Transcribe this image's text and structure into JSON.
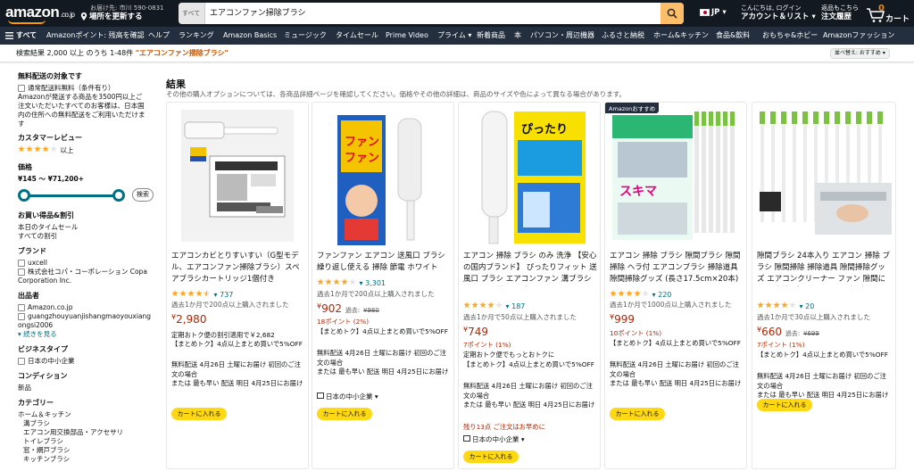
{
  "header": {
    "logo": "amazon",
    "logo_suffix": ".co.jp",
    "deliver_line1": "お届け先: 市川 590-0831",
    "deliver_line2": "場所を更新する",
    "search_category": "すべて",
    "search_query": "エアコンファン掃除ブラシ",
    "lang": "JP",
    "account_line1": "こんにちは, ログイン",
    "account_line2": "アカウント＆リスト",
    "orders_line1": "返品もこちら",
    "orders_line2": "注文履歴",
    "cart_count": "0",
    "cart_label": "カート"
  },
  "nav": {
    "all": "すべて",
    "items": [
      "Amazonポイント: 残高を確認",
      "ヘルプ",
      "ランキング",
      "Amazon Basics",
      "ミュージック",
      "タイムセール",
      "Prime Video",
      "プライム",
      "新着商品",
      "本",
      "パソコン・周辺機器",
      "ふるさと納税",
      "ホーム&キッチン",
      "食品&飲料",
      "おもちゃ&ホビー",
      "Amazonファッション"
    ]
  },
  "results": {
    "count_text": "検索結果 2,000 以上 のうち 1-48件",
    "keyword": "\"エアコンファン掃除ブラシ\"",
    "sort": "並べ替え: おすすめ"
  },
  "sidebar": {
    "shipping_title": "無料配送の対象です",
    "shipping_option": "通常配送料無料（条件有り）",
    "shipping_note": "Amazonが発送する商品を3500円以上ご注文いただいたすべてのお客様は、日本国内の住所への無料配送をご利用いただけます",
    "review_title": "カスタマーレビュー",
    "review_more": "以上",
    "price_title": "価格",
    "price_range": "¥145 〜 ¥71,200+",
    "price_go": "検索",
    "deals_title": "お買い得品&割引",
    "deals_items": [
      "本日のタイムセール",
      "すべての割引"
    ],
    "brand_title": "ブランド",
    "brand_items": [
      "uxcell",
      "株式会社コパ・コーポレーション Copa Corporation Inc."
    ],
    "seller_title": "出品者",
    "seller_items": [
      "Amazon.co.jp",
      "guangzhouyuanjishangmaoyouxiangongsi2006"
    ],
    "seller_more": "続きを見る",
    "business_title": "ビジネスタイプ",
    "business_items": [
      "日本の中小企業"
    ],
    "condition_title": "コンディション",
    "condition_value": "新品",
    "category_title": "カテゴリー",
    "category_items": [
      "ホーム＆キッチン",
      "溝ブラシ",
      "エアコン用交換部品・アクセサリ",
      "トイレブラシ",
      "窓・網戸ブラシ",
      "キッチンブラシ"
    ]
  },
  "main": {
    "title": "結果",
    "subtitle": "その他の購入オプションについては、各商品詳細ページを確認してください。価格やその他の詳細は、商品のサイズや色によって異なる場合があります。"
  },
  "products": [
    {
      "title": "エアコンカビとりすいすい（G型モデル、エアコンファン掃除ブラシ）スペアブラシカートリッジ1個付き",
      "rating_count": "737",
      "stars": 4.5,
      "bought": "過去1か月で200点以上購入されました",
      "price": "2,980",
      "line1": "定期おトク便の割引適用で￥2,682",
      "line2": "【まとめトク】4点以上まとめ買いで5%OFF",
      "line3": "無料配送 4月26日 土曜にお届け 初回のご注文の場合",
      "line4": "または 最も早い 配送 明日 4月25日にお届け",
      "cart": "カートに入れる"
    },
    {
      "title": "ファンファン エアコン 送風口 ブラシ 繰り返し使える 掃除 節電 ホワイト",
      "rating_count": "3,301",
      "stars": 4,
      "bought": "過去1か月で200点以上購入されました",
      "price": "902",
      "old_label": "過去:",
      "old_price": "¥980",
      "points": "18ポイント (2%)",
      "line2": "【まとめトク】4点以上まとめ買いで5%OFF",
      "line3": "無料配送 4月26日 土曜にお届け 初回のご注文の場合",
      "line4": "または 最も早い 配送 明日 4月25日にお届け",
      "seller": "日本の中小企業",
      "cart": "カートに入れる"
    },
    {
      "title": "エアコン 掃除 ブラシ のみ 洗浄 【安心の国内ブランド】 ぴったりフィット 送風口 ブラシ エアコンファン 溝ブラシ (エアコン送風口ブラシ…",
      "rating_count": "187",
      "stars": 4,
      "bought": "過去1か月で50点以上購入されました",
      "price": "749",
      "points": "7ポイント (1%)",
      "line1": "定期おトク便でもっとおトクに",
      "line2": "【まとめトク】4点以上まとめ買いで5%OFF",
      "line3": "無料配送 4月26日 土曜にお届け 初回のご注文の場合",
      "line4": "または 最も早い 配送 明日 4月25日にお届け",
      "stock": "残り13点 ご注文はお早めに",
      "seller": "日本の中小企業",
      "cart": "カートに入れる"
    },
    {
      "badge": "Amazonおすすめ",
      "title": "エアコン 掃除 ブラシ 隙間ブラシ 隙間掃除 ヘラ付 エアコンブラシ 掃除道具 隙間掃除グッズ (長さ17.5cm×20本)",
      "rating_count": "220",
      "stars": 4,
      "bought": "過去1か月で1000点以上購入されました",
      "price": "999",
      "points": "10ポイント (1%)",
      "line2": "【まとめトク】4点以上まとめ買いで5%OFF",
      "line3": "無料配送 4月26日 土曜にお届け 初回のご注文の場合",
      "line4": "または 最も早い 配送 明日 4月25日にお届け",
      "cart": "カートに入れる"
    },
    {
      "title": "隙間ブラシ 24本入り エアコン 掃除 ブラシ 隙間掃除 掃除道具 隙間掃除グッズ エアコンクリーナー ファン 隙間に入る 水筒 ブラシ キッチン 掃除 …",
      "rating_count": "20",
      "stars": 4,
      "bought": "過去1か月で30点以上購入されました",
      "price": "660",
      "old_label": "過去:",
      "old_price": "¥699",
      "points": "7ポイント (1%)",
      "line2": "【まとめトク】4点以上まとめ買いで5%OFF",
      "line3": "無料配送 4月26日 土曜にお届け 初回のご注文の場合",
      "line4": "または 最も早い 配送 明日 4月25日にお届け",
      "cart": "カートに入れる"
    }
  ],
  "colors": {
    "header": "#131921",
    "nav": "#232f3e",
    "accent": "#febd69",
    "price": "#b12704",
    "link": "#007185",
    "cart_btn": "#ffd814",
    "star": "#ffa41c"
  },
  "icons": [
    "location-pin-icon",
    "search-icon",
    "hamburger-icon",
    "cart-icon",
    "caret-down-icon"
  ]
}
